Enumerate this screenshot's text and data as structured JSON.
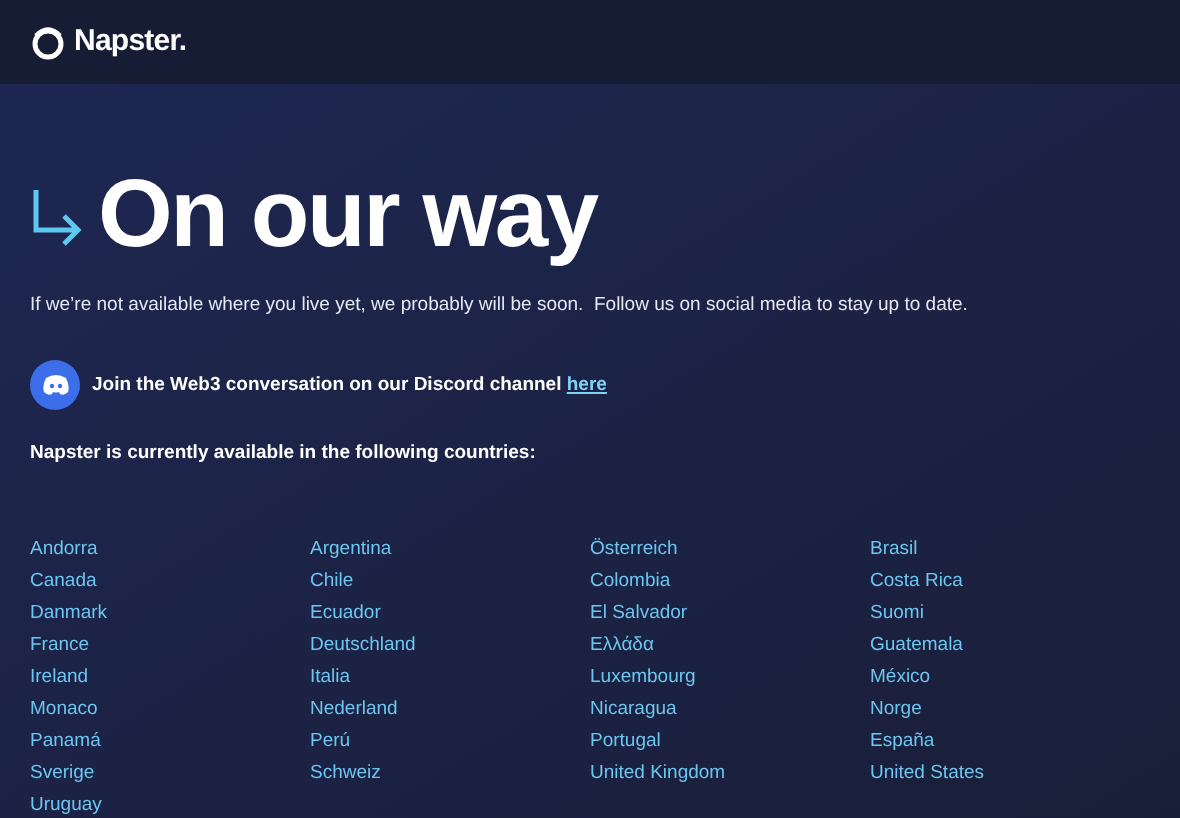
{
  "header": {
    "logo_text": "Napster."
  },
  "heading": "On our way",
  "intro": "If we’re not available where you live yet, we probably will be soon.  Follow us on social media to stay up to date.",
  "discord": {
    "text": "Join the Web3 conversation on our Discord channel",
    "link": "here"
  },
  "countries_title": "Napster is currently available in the following countries:",
  "countries": [
    "Andorra",
    "Argentina",
    "Österreich",
    "Brasil",
    "Canada",
    "Chile",
    "Colombia",
    "Costa Rica",
    "Danmark",
    "Ecuador",
    "El Salvador",
    "Suomi",
    "France",
    "Deutschland",
    "Ελλάδα",
    "Guatemala",
    "Ireland",
    "Italia",
    "Luxembourg",
    "México",
    "Monaco",
    "Nederland",
    "Nicaragua",
    "Norge",
    "Panamá",
    "Perú",
    "Portugal",
    "España",
    "Sverige",
    "Schweiz",
    "United Kingdom",
    "United States",
    "Uruguay"
  ]
}
